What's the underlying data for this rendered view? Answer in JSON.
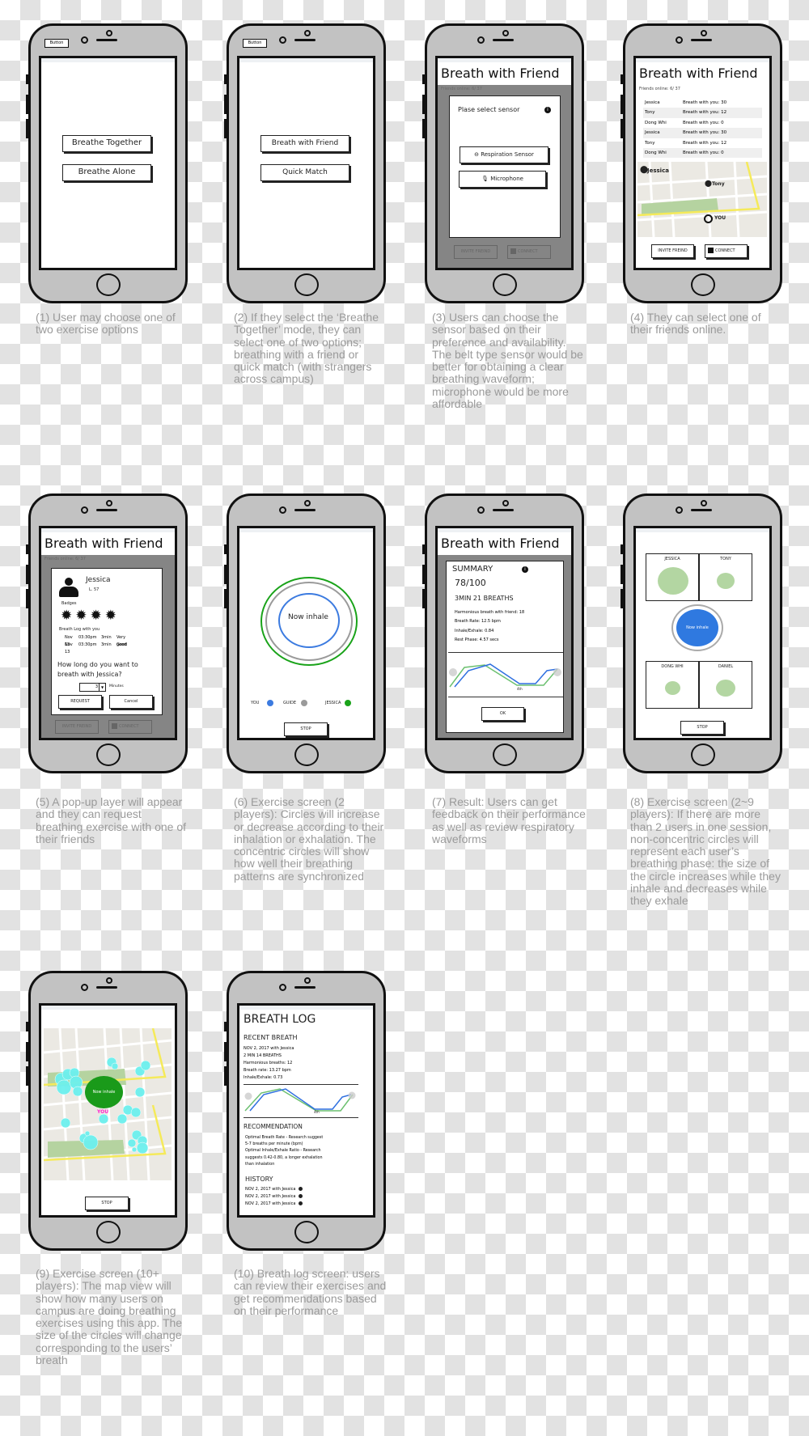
{
  "colors": {
    "you": "#3c7be0",
    "guide": "#9a9a9a",
    "friend": "#1aa31a",
    "map_bg": "#ebe9e3",
    "park": "#b5d3a0",
    "road": "#f5ea5a",
    "users": "#6cf0ee",
    "you_label": "#ff22cc",
    "bubble": "#b3d6a2"
  },
  "phones": [
    {
      "top_button": "Button",
      "buttons": [
        "Breathe Together",
        "Breathe Alone"
      ],
      "caption": "(1) User may choose one of two exercise options"
    },
    {
      "top_button": "Button",
      "buttons": [
        "Breath with Friend",
        "Quick Match"
      ],
      "caption": "(2) If they select the ‘Breathe Together’ mode, they can select one of two options; breathing with a friend or quick match (with strangers across campus)"
    },
    {
      "title": "Breath with Friend",
      "friends_online": "Friends online: 6/ 37",
      "modal_title": "Plase select sensor",
      "sensor_buttons": [
        {
          "label": "Respiration Sensor",
          "icon": "belt-sensor-icon"
        },
        {
          "label": "Microphone",
          "icon": "microphone-icon"
        }
      ],
      "invite": "INVITE FREIND",
      "connect": "CONNECT",
      "caption": "(3) Users can choose the sensor based on their preference and availability. The belt type sensor would be better for obtaining a clear breathing waveform; microphone would be more affordable"
    },
    {
      "title": "Breath with Friend",
      "friends_online": "Friends online: 6/ 37",
      "friends": [
        {
          "name": "Jessica",
          "info": "Breath with you: 30"
        },
        {
          "name": "Tony",
          "info": "Breath with you: 12"
        },
        {
          "name": "Dong Whi",
          "info": "Breath with you: 0"
        },
        {
          "name": "Jessica",
          "info": "Breath with you: 30"
        },
        {
          "name": "Tony",
          "info": "Breath with you: 12"
        },
        {
          "name": "Dong Whi",
          "info": "Breath with you: 0"
        }
      ],
      "map_labels": {
        "jessica": "Jessica",
        "tony": "Tony",
        "you": "YOU"
      },
      "invite": "INVITE FREIND",
      "connect": "CONNECT",
      "caption": "(4) They can select one of their friends online."
    },
    {
      "title": "Breath with Friend",
      "friends_online": "Friends online: 6/ 37",
      "name": "Jessica",
      "level": "L. 57",
      "badges_label": "Badges",
      "log_label": "Breath Log with you",
      "log": [
        [
          "Nov 13",
          "03:30pm",
          "3min",
          "Very good"
        ],
        [
          "Nov 13",
          "03:30pm",
          "3min",
          "Good"
        ]
      ],
      "question": "How long do you want to breath with Jessica?",
      "minutes_value": "3",
      "minutes_label": "Minutes",
      "request": "REQUEST",
      "cancel": "Cancel",
      "invite": "INVITE FREIND",
      "connect": "CONNECT",
      "caption": "(5) A pop-up layer will appear and they can request breathing exercise with one of their friends"
    },
    {
      "center": "Now inhale",
      "legend": [
        "YOU",
        "GUIDE",
        "JESSICA"
      ],
      "stop": "STOP",
      "caption": "(6) Exercise screen  (2 players): Circles will increase or decrease according to their inhalation or exhalation. The concentric circles will show how well their breathing patterns are synchronized"
    },
    {
      "title": "Breath with Friend",
      "summary": "SUMMARY",
      "score": "78/100",
      "duration": "3MIN 21 BREATHS",
      "stats": [
        "Harmonious breath with friend: 18",
        "Breath Rate: 12.5 bpm",
        "Inhale/Exhale: 0.84",
        "Rest Phase: 4.57 secs"
      ],
      "wave_label": "4th",
      "ok": "OK",
      "caption": "(7) Result: Users can get feedback on their performance as well as review respiratory waveforms"
    },
    {
      "players": [
        "JESSICA",
        "TONY",
        "DONG WHI",
        "DANIEL"
      ],
      "center": "Now inhale",
      "stop": "STOP",
      "caption": "(8) Exercise screen (2~9 players): If there are more than 2 users in one session, non-concentric circles will represent each user’s breathing phase: the size of the circle increases while they inhale and decreases while they exhale"
    },
    {
      "center": "Now inhale",
      "you": "YOU",
      "stop": "STOP",
      "caption": "(9) Exercise screen (10+ players): The map view will show how many users on campus are doing breathing exercises using this app. The size of the circles will change corresponding to the users’ breath"
    },
    {
      "title": "BREATH LOG",
      "recent_title": "RECENT BREATH",
      "recent": [
        "NOV 2, 2017 with Jessica",
        "2 MIN 14 BREATHS",
        "Harmonious breaths: 12",
        "Breath rate: 13.27 bpm",
        "Inhale/Exhale: 0.73"
      ],
      "wave_label": "4th",
      "rec_title": "RECOMMENDATION",
      "rec": [
        "Optimal Breath Rate - Research suggest",
        "5-7 breaths per minute (bpm)",
        "Optimal Inhale/Exhale Ratio - Research",
        "suggests 0.42-0.80, a longer exhalation",
        "than inhalation"
      ],
      "history_title": "HISTORY",
      "history": [
        "NOV 2, 2017 with Jessica",
        "NOV 2, 2017 with Jessica",
        "NOV 2, 2017 with Jessica"
      ],
      "caption": "(10) Breath log screen: users can review their exercises and get recommendations based on their performance"
    }
  ]
}
